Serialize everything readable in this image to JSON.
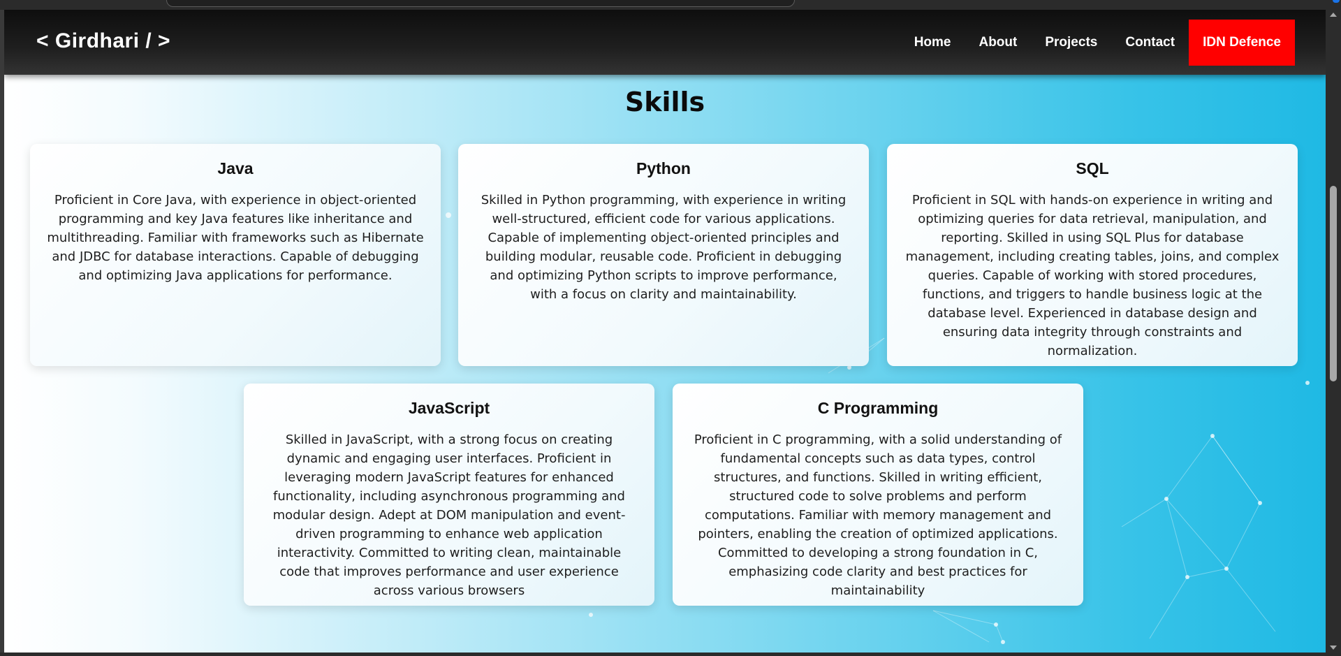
{
  "navbar": {
    "logo": "< Girdhari / >",
    "links": [
      "Home",
      "About",
      "Projects",
      "Contact"
    ],
    "cta": "IDN Defence"
  },
  "skills": {
    "title": "Skills",
    "cards": [
      {
        "title": "Java",
        "text": "Proficient in Core Java, with experience in object-oriented programming and key Java features like inheritance and multithreading. Familiar with frameworks such as Hibernate and JDBC for database interactions. Capable of debugging and optimizing Java applications for performance."
      },
      {
        "title": "Python",
        "text": "Skilled in Python programming, with experience in writing well-structured, efficient code for various applications. Capable of implementing object-oriented principles and building modular, reusable code. Proficient in debugging and optimizing Python scripts to improve performance, with a focus on clarity and maintainability."
      },
      {
        "title": "SQL",
        "text": "Proficient in SQL with hands-on experience in writing and optimizing queries for data retrieval, manipulation, and reporting. Skilled in using SQL Plus for database management, including creating tables, joins, and complex queries. Capable of working with stored procedures, functions, and triggers to handle business logic at the database level. Experienced in database design and ensuring data integrity through constraints and normalization."
      },
      {
        "title": "JavaScript",
        "text": "Skilled in JavaScript, with a strong focus on creating dynamic and engaging user interfaces. Proficient in leveraging modern JavaScript features for enhanced functionality, including asynchronous programming and modular design. Adept at DOM manipulation and event-driven programming to enhance web application interactivity. Committed to writing clean, maintainable code that improves performance and user experience across various browsers"
      },
      {
        "title": "C Programming",
        "text": "Proficient in C programming, with a solid understanding of fundamental concepts such as data types, control structures, and functions. Skilled in writing efficient, structured code to solve problems and perform computations. Familiar with memory management and pointers, enabling the creation of optimized applications. Committed to developing a strong foundation in C, emphasizing code clarity and best practices for maintainability"
      }
    ]
  },
  "colors": {
    "cta_bg": "#ff0000",
    "navbar_bg": "#111111",
    "accent_cyan": "#1fb9e4"
  }
}
